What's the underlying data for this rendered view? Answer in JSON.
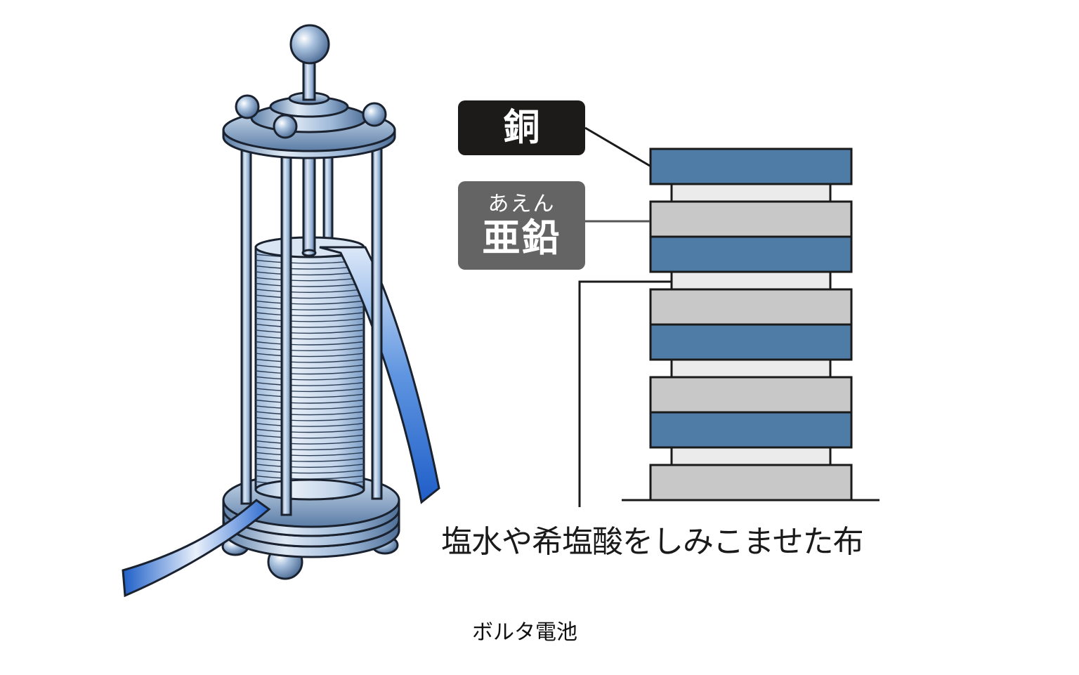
{
  "labels": {
    "copper": "銅",
    "zinc_ruby": "あえん",
    "zinc": "亜鉛",
    "cloth": "塩水や希塩酸をしみこませた布"
  },
  "caption": "ボルタ電池",
  "colors": {
    "copper_plate": "#4e7ca6",
    "zinc_plate": "#c8c8c8",
    "cloth_layer": "#ebebeb",
    "copper_label_bg": "#1d1a1a",
    "zinc_label_bg": "#646464",
    "metal": "#9bb6d6",
    "wire": "#2f6bd0"
  },
  "stack_layers": [
    "copper",
    "cloth",
    "zinc",
    "copper",
    "cloth",
    "zinc",
    "copper",
    "cloth",
    "zinc",
    "copper",
    "cloth",
    "zinc"
  ]
}
